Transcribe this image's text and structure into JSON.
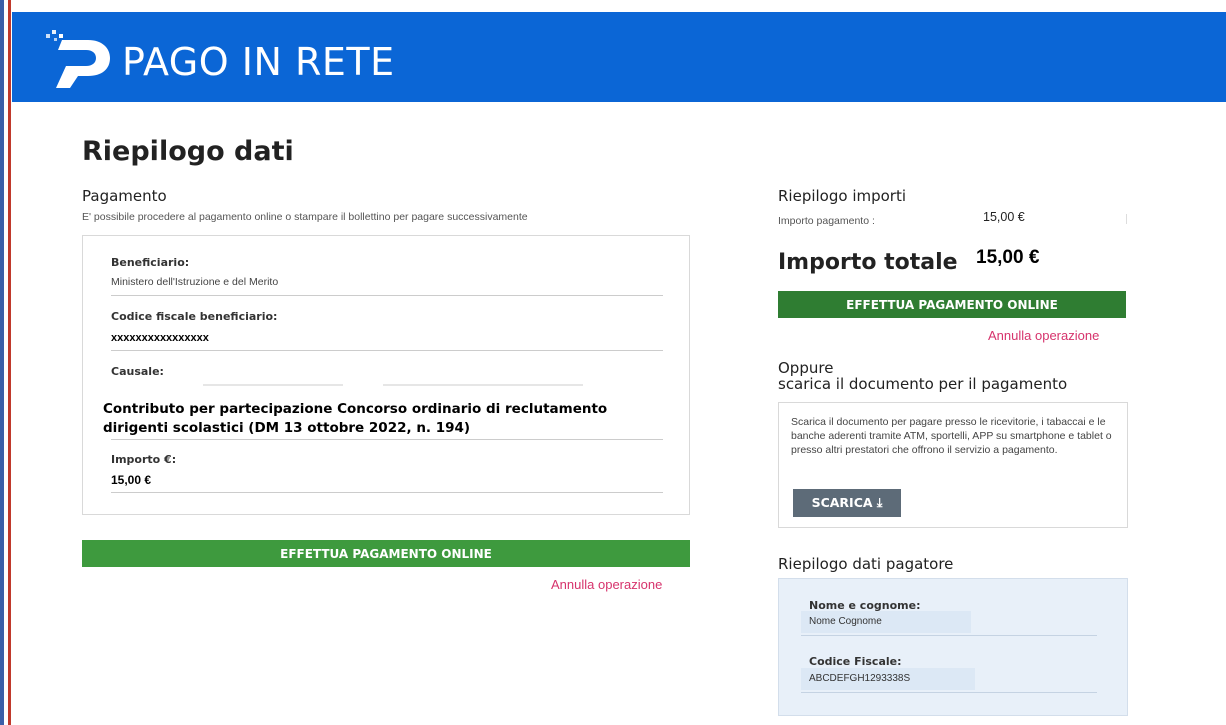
{
  "header": {
    "brand": "PAGO IN RETE"
  },
  "page_title": "Riepilogo dati",
  "payment": {
    "section_title": "Pagamento",
    "description": "E' possibile procedere al pagamento online o stampare il bollettino per pagare successivamente",
    "beneficiario_label": "Beneficiario:",
    "beneficiario_value": "Ministero dell'Istruzione e del Merito",
    "codice_fiscale_label": "Codice fiscale beneficiario:",
    "codice_fiscale_value": "xxxxxxxxxxxxxxxx",
    "causale_label": "Causale:",
    "causale_value": "Contributo per partecipazione Concorso ordinario di reclutamento dirigenti scolastici (DM 13 ottobre 2022, n. 194)",
    "importo_label": "Importo €:",
    "importo_value": "15,00 €",
    "pay_button": "EFFETTUA PAGAMENTO ONLINE",
    "cancel_link": "Annulla operazione"
  },
  "summary": {
    "title": "Riepilogo importi",
    "importo_label": "Importo pagamento :",
    "importo_value": "15,00 €",
    "total_label": "Importo totale",
    "total_value": "15,00 €",
    "pay_button": "EFFETTUA PAGAMENTO ONLINE",
    "cancel_link": "Annulla operazione"
  },
  "download": {
    "title_line1": "Oppure",
    "title_line2": "scarica il documento per il pagamento",
    "text": "Scarica il documento per pagare presso le ricevitorie, i tabaccai e le banche aderenti tramite ATM, sportelli, APP su smartphone e tablet o presso altri prestatori che offrono il servizio a pagamento.",
    "button": "SCARICA ⤓"
  },
  "payer": {
    "title": "Riepilogo dati pagatore",
    "name_label": "Nome e cognome:",
    "name_value": "Nome Cognome",
    "cf_label": "Codice Fiscale:",
    "cf_value": "ABCDEFGH1293338S"
  },
  "colors": {
    "header_blue": "#0b66d6",
    "pay_green": "#3e9a3e",
    "cancel_pink": "#d6336c",
    "download_grey": "#5d6b78",
    "payer_bg": "#e8f0f9"
  }
}
